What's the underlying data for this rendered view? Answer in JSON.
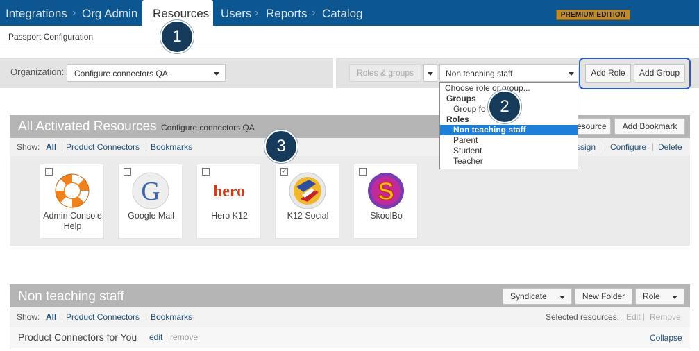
{
  "nav": {
    "integrations": "Integrations",
    "org_admin": "Org Admin",
    "resources": "Resources",
    "users": "Users",
    "reports": "Reports",
    "catalog": "Catalog",
    "separator": "›",
    "premium": "PREMIUM EDITION"
  },
  "breadcrumb": "Passport Configuration",
  "org": {
    "label": "Organization:",
    "selected": "Configure connectors QA"
  },
  "roles": {
    "roles_groups_button": "Roles & groups",
    "selected": "Non teaching staff",
    "add_role": "Add Role",
    "add_group": "Add Group"
  },
  "dropdown": {
    "placeholder": "Choose role or group...",
    "groups_header": "Groups",
    "group_item": "Group fo",
    "roles_header": "Roles",
    "items": [
      "Non teaching staff",
      "Parent",
      "Student",
      "Teacher"
    ]
  },
  "callouts": [
    "1",
    "2",
    "3"
  ],
  "activated": {
    "title": "All Activated Resources",
    "subtitle": "Configure connectors QA",
    "resource_button": "esource",
    "add_bookmark": "Add Bookmark",
    "show_label": "Show:",
    "filters": [
      "All",
      "Product Connectors",
      "Bookmarks"
    ],
    "actions": [
      "ssign",
      "Configure",
      "Delete"
    ],
    "tiles": [
      {
        "label": "Admin Console Help",
        "checked": false,
        "icon": "lifebuoy-icon"
      },
      {
        "label": "Google Mail",
        "checked": false,
        "icon": "google-g-icon"
      },
      {
        "label": "Hero K12",
        "checked": false,
        "icon": "hero-logo-icon"
      },
      {
        "label": "K12 Social",
        "checked": true,
        "icon": "k12-social-icon"
      },
      {
        "label": "SkoolBo",
        "checked": false,
        "icon": "skoolbo-icon"
      }
    ]
  },
  "staff": {
    "title": "Non teaching staff",
    "syndicate": "Syndicate",
    "new_folder": "New Folder",
    "role": "Role",
    "show_label": "Show:",
    "filters": [
      "All",
      "Product Connectors",
      "Bookmarks"
    ],
    "selected_label": "Selected resources:",
    "edit": "Edit",
    "remove": "Remove",
    "row_title": "Product Connectors for You",
    "row_edit": "edit",
    "row_remove": "remove",
    "collapse": "Collapse"
  }
}
